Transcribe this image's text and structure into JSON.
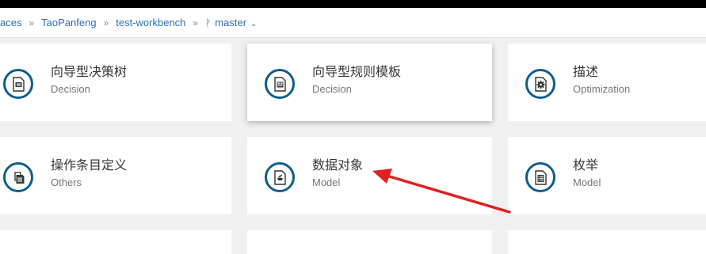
{
  "breadcrumb": {
    "spaces_fragment": "aces",
    "owner": "TaoPanfeng",
    "project": "test-workbench",
    "branch": "master",
    "separator": "»"
  },
  "cards": [
    {
      "title": "向导型决策树",
      "category": "Decision",
      "icon": "guided-decision-tree-icon"
    },
    {
      "title": "向导型规则模板",
      "category": "Decision",
      "icon": "guided-rule-template-icon",
      "selected": true
    },
    {
      "title": "描述",
      "category": "Optimization",
      "icon": "solver-config-icon"
    },
    {
      "title": "操作条目定义",
      "category": "Others",
      "icon": "work-item-definition-icon"
    },
    {
      "title": "数据对象",
      "category": "Model",
      "icon": "data-object-icon"
    },
    {
      "title": "枚举",
      "category": "Model",
      "icon": "enumeration-icon"
    }
  ],
  "annotation": {
    "type": "red-arrow",
    "color": "#e02020",
    "points_to": "数据对象"
  },
  "colors": {
    "icon_ring": "#0d5d8f",
    "link": "#2b6fb3",
    "background": "#f0f0f0"
  }
}
